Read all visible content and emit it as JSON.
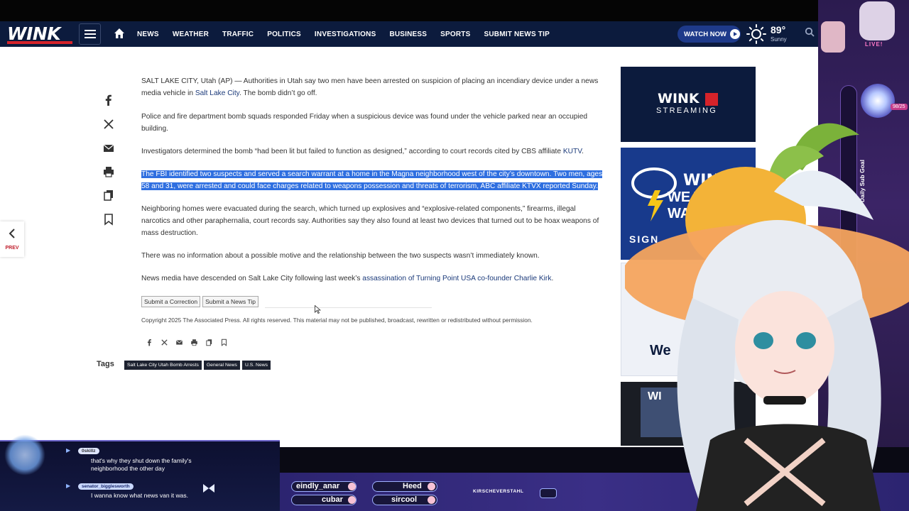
{
  "nav": {
    "logo": "WINK",
    "items": [
      "NEWS",
      "WEATHER",
      "TRAFFIC",
      "POLITICS",
      "INVESTIGATIONS",
      "BUSINESS",
      "SPORTS",
      "SUBMIT NEWS TIP"
    ],
    "watch_label": "WATCH NOW",
    "temperature": "89°",
    "condition": "Sunny"
  },
  "prev_label": "PREV",
  "article": {
    "p1_text": "SALT LAKE CITY, Utah (AP) — Authorities in Utah say two men have been arrested on suspicion of placing an incendiary device under a news media vehicle in ",
    "p1_link": "Salt Lake City",
    "p1_tail": ". The bomb didn’t go off.",
    "p2": "Police and fire department bomb squads responded Friday when a suspicious device was found under the vehicle parked near an occupied building.",
    "p3_text": "Investigators determined the bomb “had been lit but failed to function as designed,” according to court records cited by CBS affiliate ",
    "p3_link": "KUTV",
    "p3_tail": ".",
    "p4_line1": "The FBI identified two suspects and served a search warrant at a home in the Magna neighborhood west of the city’s downtown. Two men, ages",
    "p4_line2": "58 and 31, were arrested and could face charges related to weapons possession and threats of terrorism, ABC affiliate KTVX reported Sunday.",
    "p5": "Neighboring homes were evacuated during the search, which turned up explosives and “explosive-related components,” firearms, illegal narcotics and other paraphernalia, court records say. Authorities say they also found at least two devices that turned out to be hoax weapons of mass destruction.",
    "p6": "There was no information about a possible motive and the relationship between the two suspects wasn’t immediately known.",
    "p7_text": "News media have descended on Salt Lake City following last week’s ",
    "p7_link": "assassination of Turning Point USA co-founder Charlie Kirk",
    "p7_tail": ".",
    "correction_label": "Submit a Correction",
    "tip_label": "Submit a News Tip",
    "copyright": "Copyright 2025 The Associated Press. All rights reserved. This material may not be published, broadcast, rewritten or redistributed without permission.",
    "tags_label": "Tags",
    "tags": [
      "Salt Lake City Utah Bomb Arrests",
      "General News",
      "U.S. News"
    ]
  },
  "sidebar": {
    "ad1_logo": "WINK",
    "ad1_sub": "STREAMING",
    "ad2_logo": "WINK",
    "ad2_line1": "WEAT",
    "ad2_line2": "WAT",
    "ad2_sign": "SIGN",
    "ad3_text": "We",
    "ad4_text": "WI"
  },
  "stream": {
    "live": "LIVE!",
    "goal_label": "Daily Sub Goal",
    "goal_count": "98/25",
    "users": [
      "eindly_anar",
      "Heed",
      "cubar",
      "sircool"
    ],
    "streamer": "KIRSCHEVERSTAHL",
    "chat": [
      {
        "user": "0skillz",
        "message_line1": "that's why they shut down the family's",
        "message_line2": "neighborhood the other day"
      },
      {
        "user": "senator_bigglesworth",
        "message_line1": "I wanna know what news van it was.",
        "message_line2": ""
      }
    ]
  },
  "colors": {
    "nav_bg": "#0c1b3d",
    "brand_red": "#d6232a",
    "highlight": "#2f6fe0",
    "link": "#1b3a7a"
  }
}
